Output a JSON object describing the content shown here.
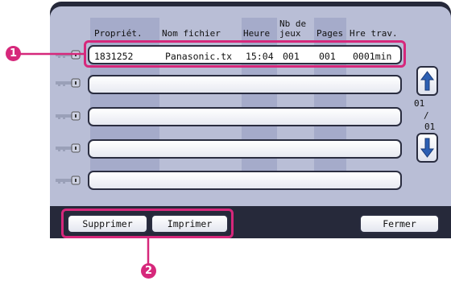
{
  "columns": {
    "owner": "Propriét.",
    "filename": "Nom fichier",
    "time": "Heure",
    "sets_line1": "Nb de",
    "sets_line2": "jeux",
    "pages": "Pages",
    "work_time": "Hre trav."
  },
  "rows": [
    {
      "owner": "1831252",
      "filename": "Panasonic.tx",
      "time": "15:04",
      "sets": "001",
      "pages": "001",
      "work_time": "0001min"
    },
    {
      "owner": "",
      "filename": "",
      "time": "",
      "sets": "",
      "pages": "",
      "work_time": ""
    },
    {
      "owner": "",
      "filename": "",
      "time": "",
      "sets": "",
      "pages": "",
      "work_time": ""
    },
    {
      "owner": "",
      "filename": "",
      "time": "",
      "sets": "",
      "pages": "",
      "work_time": ""
    },
    {
      "owner": "",
      "filename": "",
      "time": "",
      "sets": "",
      "pages": "",
      "work_time": ""
    }
  ],
  "page_indicator": {
    "current": "01",
    "separator": "/",
    "total": "01"
  },
  "buttons": {
    "delete": "Supprimer",
    "print": "Imprimer",
    "close": "Fermer"
  },
  "callouts": {
    "one": "1",
    "two": "2"
  },
  "icons": {
    "row_icon": "key-icon",
    "up": "arrow-up-icon",
    "down": "arrow-down-icon"
  },
  "colors": {
    "highlight": "#d6287b",
    "panel": "#26293a",
    "list_bg": "#b9bed6",
    "band": "#a5abca"
  }
}
